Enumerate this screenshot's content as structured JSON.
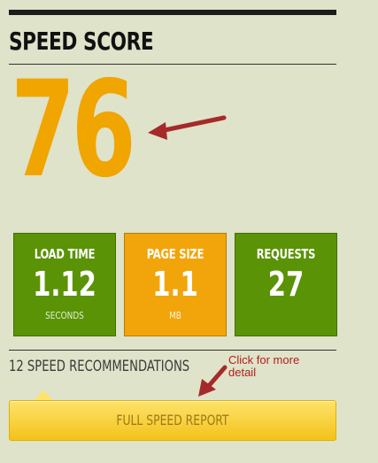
{
  "header": {
    "title": "SPEED SCORE"
  },
  "score": {
    "value": "76",
    "color": "#f0a500"
  },
  "metrics": [
    {
      "label": "LOAD TIME",
      "value": "1.12",
      "unit": "SECONDS",
      "color": "#5a9306"
    },
    {
      "label": "PAGE SIZE",
      "value": "1.1",
      "unit": "MB",
      "color": "#f2a50a"
    },
    {
      "label": "REQUESTS",
      "value": "27",
      "unit": "",
      "color": "#5a9306"
    }
  ],
  "recommendations": {
    "text": "12 SPEED RECOMMENDATIONS"
  },
  "callout": {
    "text": "Click for more detail",
    "color": "#b02020"
  },
  "report_button": {
    "label": "FULL SPEED REPORT"
  },
  "icons": {
    "arrow": "arrow-annotation-icon"
  }
}
